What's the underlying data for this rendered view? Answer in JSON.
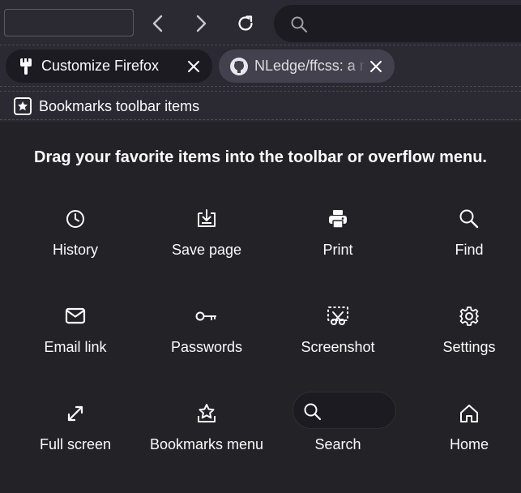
{
  "nav": {
    "back_icon": "chevron-left-icon",
    "forward_icon": "chevron-right-icon",
    "reload_icon": "reload-icon",
    "urlbar_icon": "search-icon"
  },
  "tabs": [
    {
      "title": "Customize Firefox",
      "favicon": "paintbrush-icon",
      "active": true
    },
    {
      "title": "NLedge/ffcss: a modern",
      "favicon": "github-icon",
      "active": false
    }
  ],
  "bookmarks_toolbar": {
    "label": "Bookmarks toolbar items",
    "icon": "bookmark-star-icon"
  },
  "palette": {
    "heading": "Drag your favorite items into the toolbar or overflow menu.",
    "items": [
      {
        "label": "History",
        "icon": "clock-icon"
      },
      {
        "label": "Save page",
        "icon": "save-page-icon"
      },
      {
        "label": "Print",
        "icon": "printer-icon"
      },
      {
        "label": "Find",
        "icon": "search-icon"
      },
      {
        "label": "Email link",
        "icon": "envelope-icon"
      },
      {
        "label": "Passwords",
        "icon": "key-icon"
      },
      {
        "label": "Screenshot",
        "icon": "screenshot-icon"
      },
      {
        "label": "Settings",
        "icon": "gear-icon"
      },
      {
        "label": "Full screen",
        "icon": "fullscreen-icon"
      },
      {
        "label": "Bookmarks menu",
        "icon": "bookmark-star-icon"
      },
      {
        "label": "Search",
        "icon": "search-icon"
      },
      {
        "label": "Home",
        "icon": "home-icon"
      }
    ]
  },
  "colors": {
    "toolbar_bg": "#2b2a33",
    "content_bg": "#232226",
    "field_bg": "#1c1b22",
    "text": "#fbfbfe"
  }
}
